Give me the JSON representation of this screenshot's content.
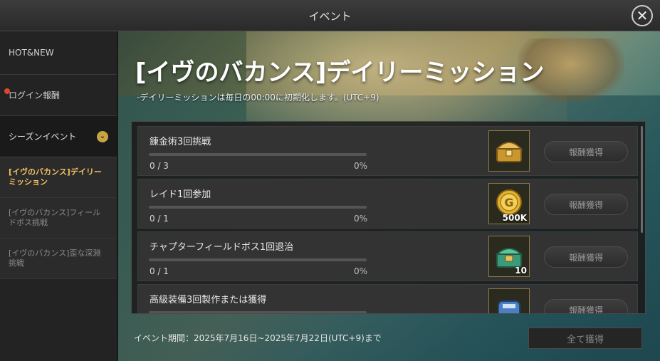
{
  "window": {
    "title": "イベント",
    "close_icon": "close-icon"
  },
  "sidebar": {
    "hot_new": "HOT&NEW",
    "login_reward": "ログイン報酬",
    "season_event": "シーズンイベント",
    "season_arrow": "⌄",
    "sub_items": [
      {
        "label": "[イヴのバカンス]デイリーミッション",
        "active": true
      },
      {
        "label": "[イヴのバカンス]フィールドボス挑戦",
        "active": false
      },
      {
        "label": "[イヴのバカンス]歪な深淵挑戦",
        "active": false
      }
    ]
  },
  "main": {
    "title": "[イヴのバカンス]デイリーミッション",
    "subtitle": "-デイリーミッションは毎日の00:00に初期化します。(UTC+9)",
    "missions": [
      {
        "name": "錬金術3回挑戦",
        "count": "0 / 3",
        "percent": "0%",
        "progress": 0,
        "reward_icon": "golden-chest-icon",
        "reward_qty": "",
        "button": "報酬獲得"
      },
      {
        "name": "レイド1回参加",
        "count": "0 / 1",
        "percent": "0%",
        "progress": 0,
        "reward_icon": "gold-coin-icon",
        "reward_qty": "500K",
        "button": "報酬獲得"
      },
      {
        "name": "チャプターフィールドボス1回退治",
        "count": "0 / 1",
        "percent": "0%",
        "progress": 0,
        "reward_icon": "green-chest-icon",
        "reward_qty": "10",
        "button": "報酬獲得"
      },
      {
        "name": "高級装備3回製作または獲得",
        "count": "",
        "percent": "",
        "progress": 0,
        "reward_icon": "blue-item-icon",
        "reward_qty": "",
        "button": "報酬獲得"
      }
    ],
    "period": "イベント期間：2025年7月16日~2025年7月22日(UTC+9)まで",
    "claim_all": "全て獲得"
  },
  "colors": {
    "accent": "#f0c264",
    "progress": "#d0a84e",
    "red_dot": "#e0442e"
  }
}
